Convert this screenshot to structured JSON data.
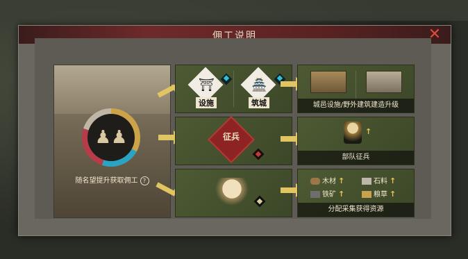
{
  "dialog": {
    "title": "佣工说明",
    "close": "✕"
  },
  "portrait": {
    "caption": "随名望提升获取佣工",
    "help": "?",
    "ring_colors": [
      "#cda34a",
      "#2aa4c2",
      "#b53c48",
      "#bfb6a6"
    ]
  },
  "row1": {
    "left_items": [
      "设施",
      "筑城"
    ],
    "result_label": "城邑设施/野外建筑建造升级"
  },
  "row2": {
    "center_label": "征兵",
    "result_label": "部队征兵"
  },
  "row3": {
    "result_label": "分配采集获得资源",
    "resources": [
      {
        "name": "木材",
        "icon": "wood-icon"
      },
      {
        "name": "石料",
        "icon": "stone-icon"
      },
      {
        "name": "铁矿",
        "icon": "iron-icon"
      },
      {
        "name": "粮草",
        "icon": "grain-icon"
      }
    ]
  },
  "colors": {
    "accent_yellow": "#e0c562",
    "close_red": "#e04a3a",
    "teal": "#2ec0d4"
  }
}
